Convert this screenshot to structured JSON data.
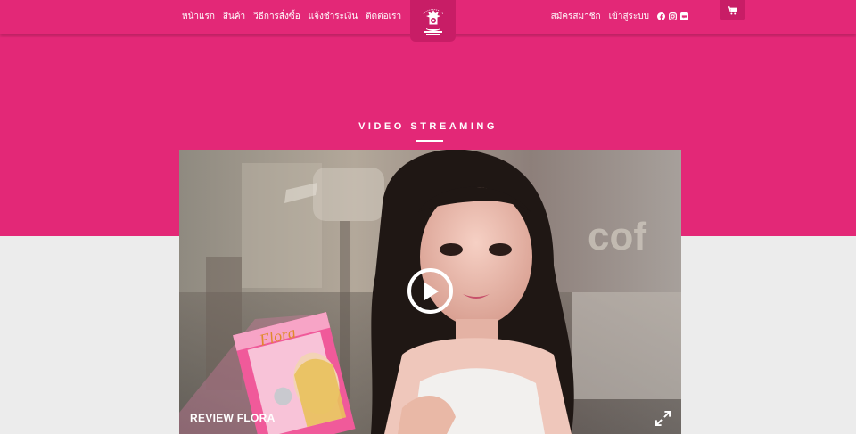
{
  "nav": {
    "links": [
      "หน้าแรก",
      "สินค้า",
      "วิธีการสั่งซื้อ",
      "แจ้งชำระเงิน",
      "ติดต่อเรา"
    ],
    "register": "สมัครสมาชิก",
    "login": "เข้าสู่ระบบ"
  },
  "social_icons": [
    "facebook-icon",
    "instagram-icon",
    "line-icon"
  ],
  "section": {
    "title": "VIDEO STREAMING"
  },
  "video": {
    "caption": "REVIEW FLORA",
    "product_text": "Flora"
  },
  "colors": {
    "brand_pink": "#e32877",
    "dark_pink": "#c81d66",
    "background_gray": "#ececec"
  }
}
